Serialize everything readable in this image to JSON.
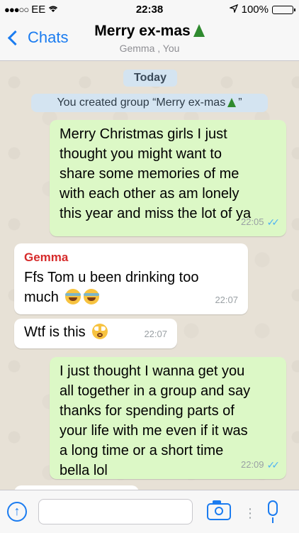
{
  "status_bar": {
    "carrier": "EE",
    "time": "22:38",
    "battery": "100%"
  },
  "nav": {
    "back_label": "Chats",
    "title": "Merry ex-mas",
    "subtitle": "Gemma , You"
  },
  "chat": {
    "date_label": "Today",
    "system_message": "You created group “Merry ex-mas",
    "system_message_end": "”",
    "messages": [
      {
        "direction": "out",
        "lines": [
          "Merry Christmas girls I just",
          "thought you might want to",
          "share some memories of me",
          "with each other as am lonely",
          "this year and miss the lot of ya"
        ],
        "time": "22:05"
      },
      {
        "direction": "in",
        "sender": "Gemma",
        "lines": [
          "Ffs Tom u been drinking too",
          "much"
        ],
        "time": "22:07"
      },
      {
        "direction": "in",
        "lines": [
          "Wtf is this"
        ],
        "time": "22:07"
      },
      {
        "direction": "out",
        "lines": [
          "I just thought I wanna get you",
          "all together in a group and say",
          "thanks for spending parts of",
          "your life with me even if it was",
          "a long time or a short time",
          "bella lol"
        ],
        "time": "22:09"
      }
    ]
  },
  "icons": {
    "signal": "signal-dots-icon",
    "wifi": "wifi-icon",
    "location": "location-arrow-icon",
    "battery": "battery-icon",
    "back": "chevron-left-icon",
    "tree": "christmas-tree-emoji",
    "read": "double-check-icon",
    "attach": "arrow-up-circle-icon",
    "camera": "camera-icon",
    "mic": "microphone-icon"
  },
  "colors": {
    "accent": "#1b7cf0",
    "outgoing_bubble": "#dcf8c6",
    "incoming_bubble": "#ffffff",
    "sender_name": "#d62b2b",
    "read_ticks": "#4fb3f3"
  }
}
